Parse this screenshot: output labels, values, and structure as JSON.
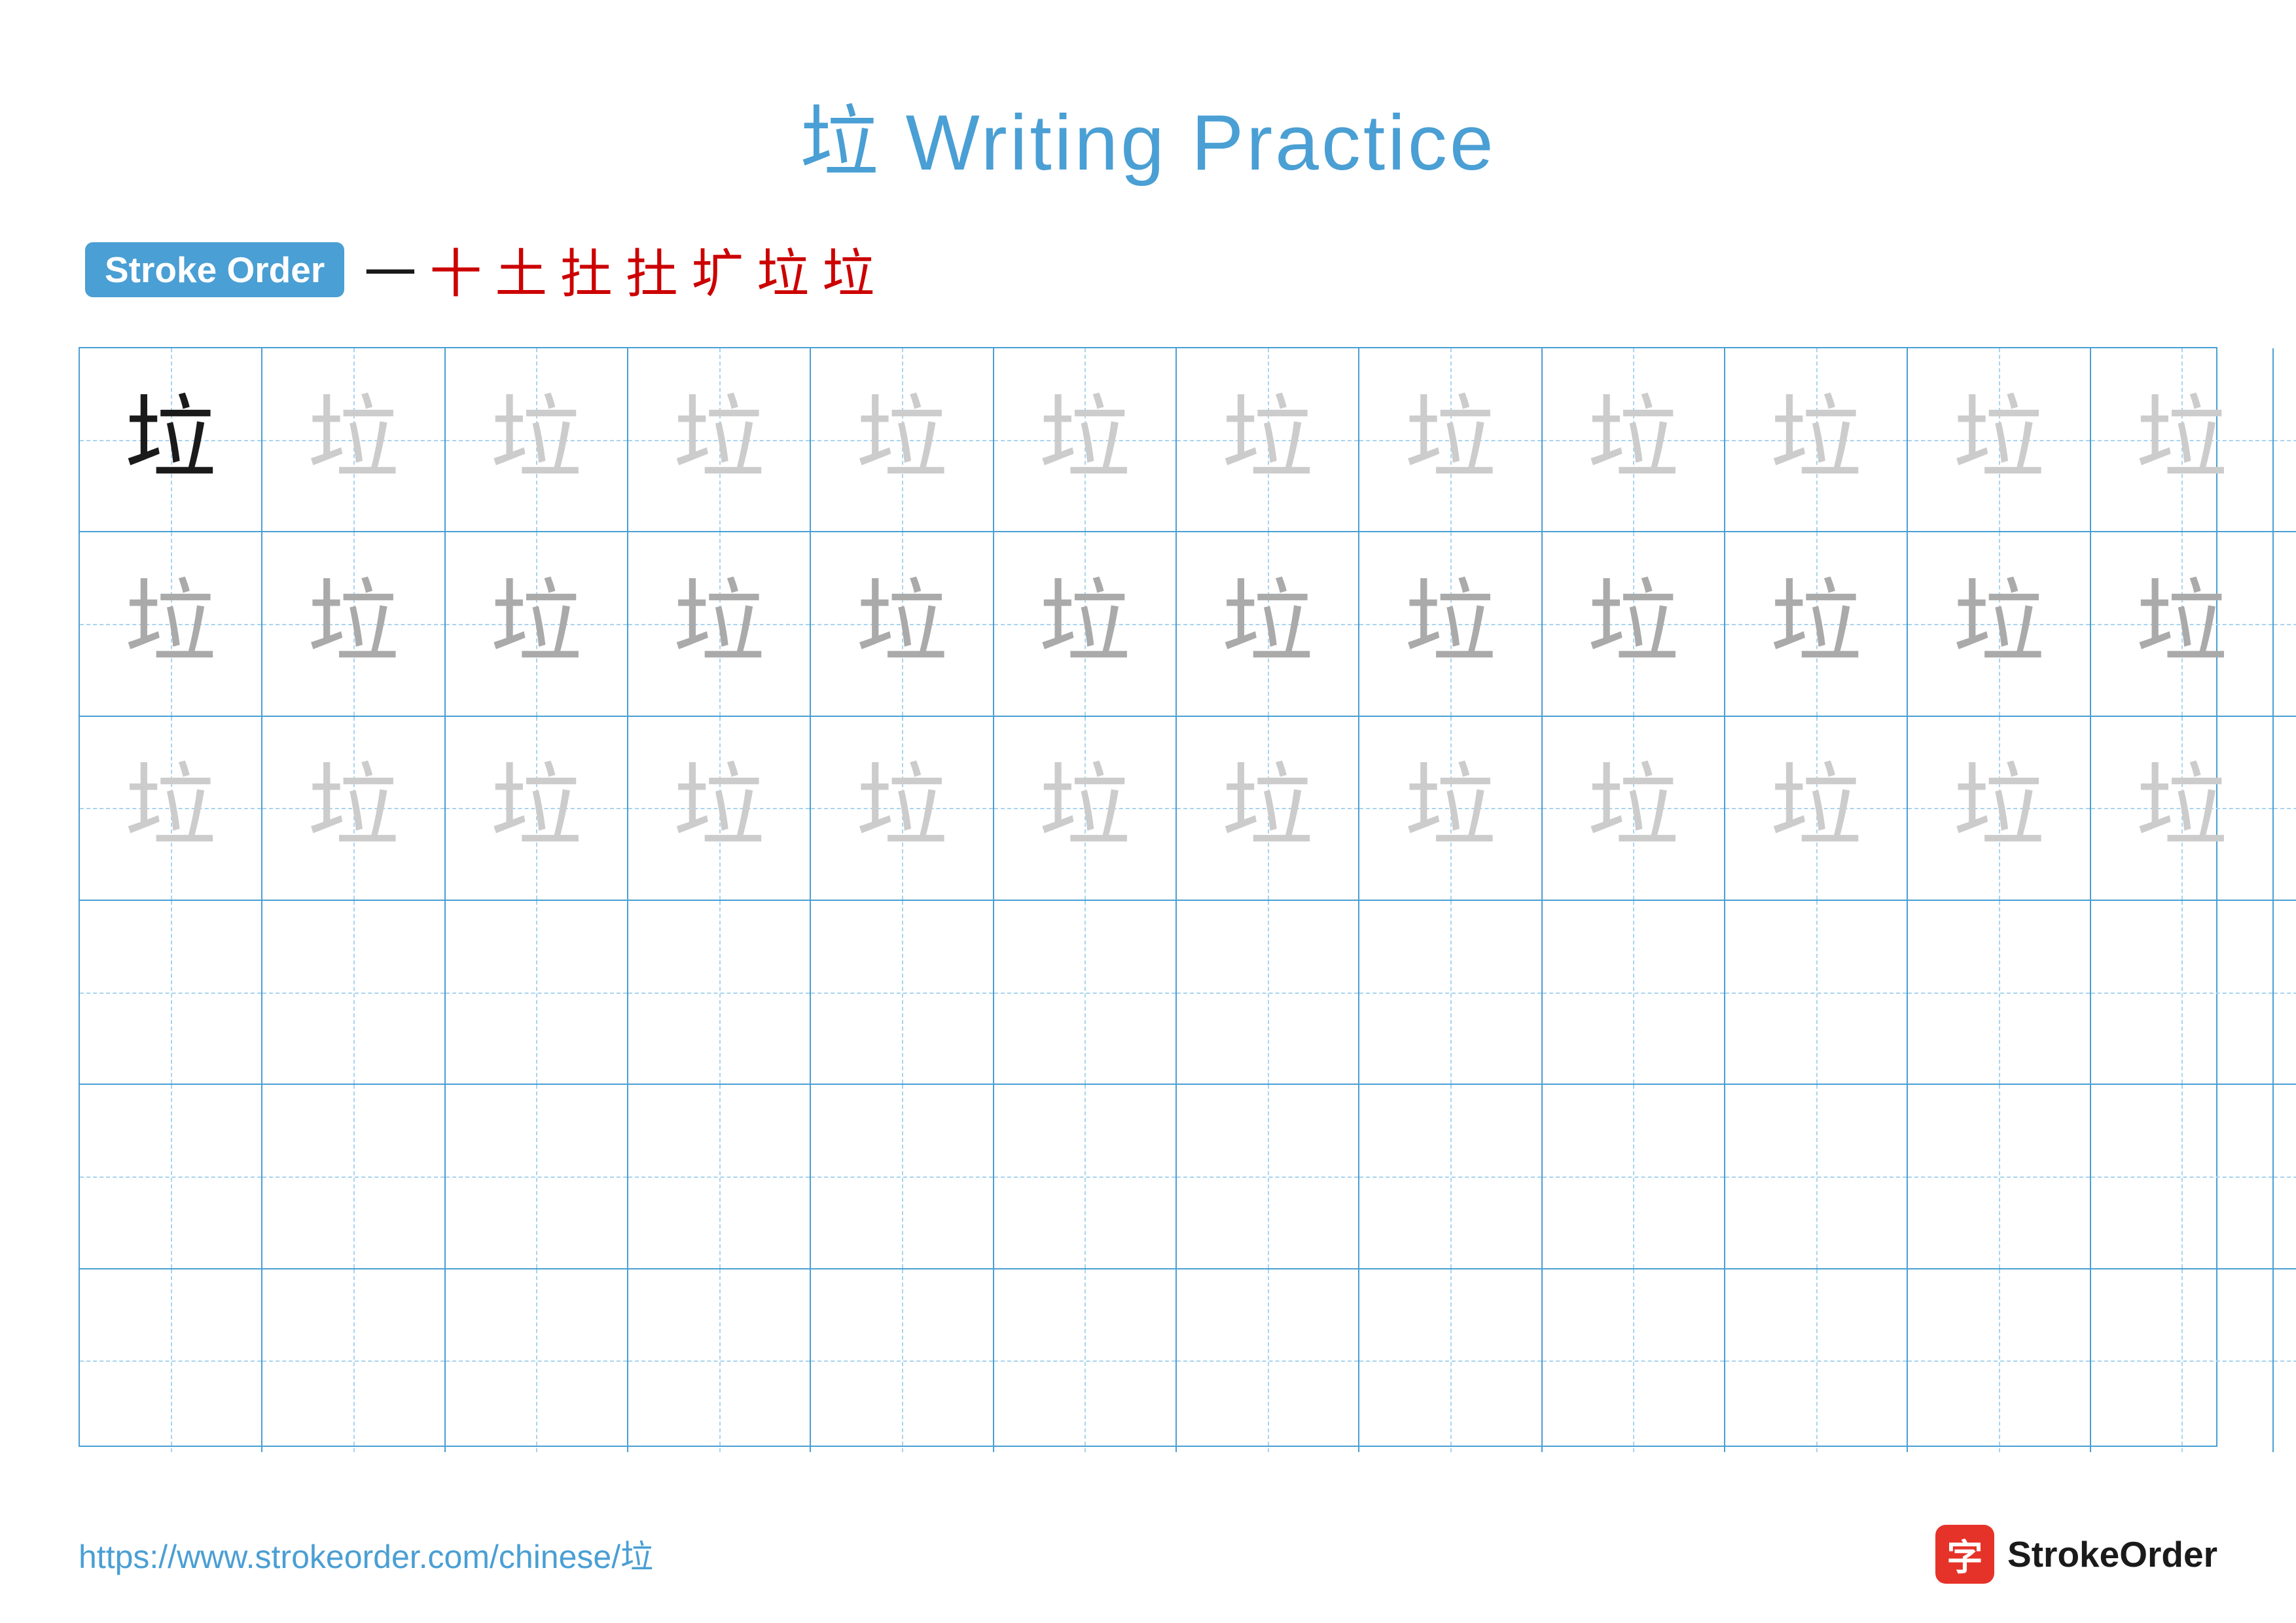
{
  "title": "垃 Writing Practice",
  "stroke_order": {
    "badge_label": "Stroke Order",
    "steps": [
      "一",
      "十",
      "土",
      "扗",
      "扗",
      "圹",
      "垃",
      "垃"
    ]
  },
  "grid": {
    "rows": 6,
    "cols": 13,
    "char": "垃",
    "row_types": [
      "dark_then_light",
      "light",
      "lighter",
      "empty",
      "empty",
      "empty"
    ]
  },
  "footer": {
    "url": "https://www.strokeorder.com/chinese/垃",
    "logo_char": "字",
    "logo_text": "StrokeOrder"
  }
}
